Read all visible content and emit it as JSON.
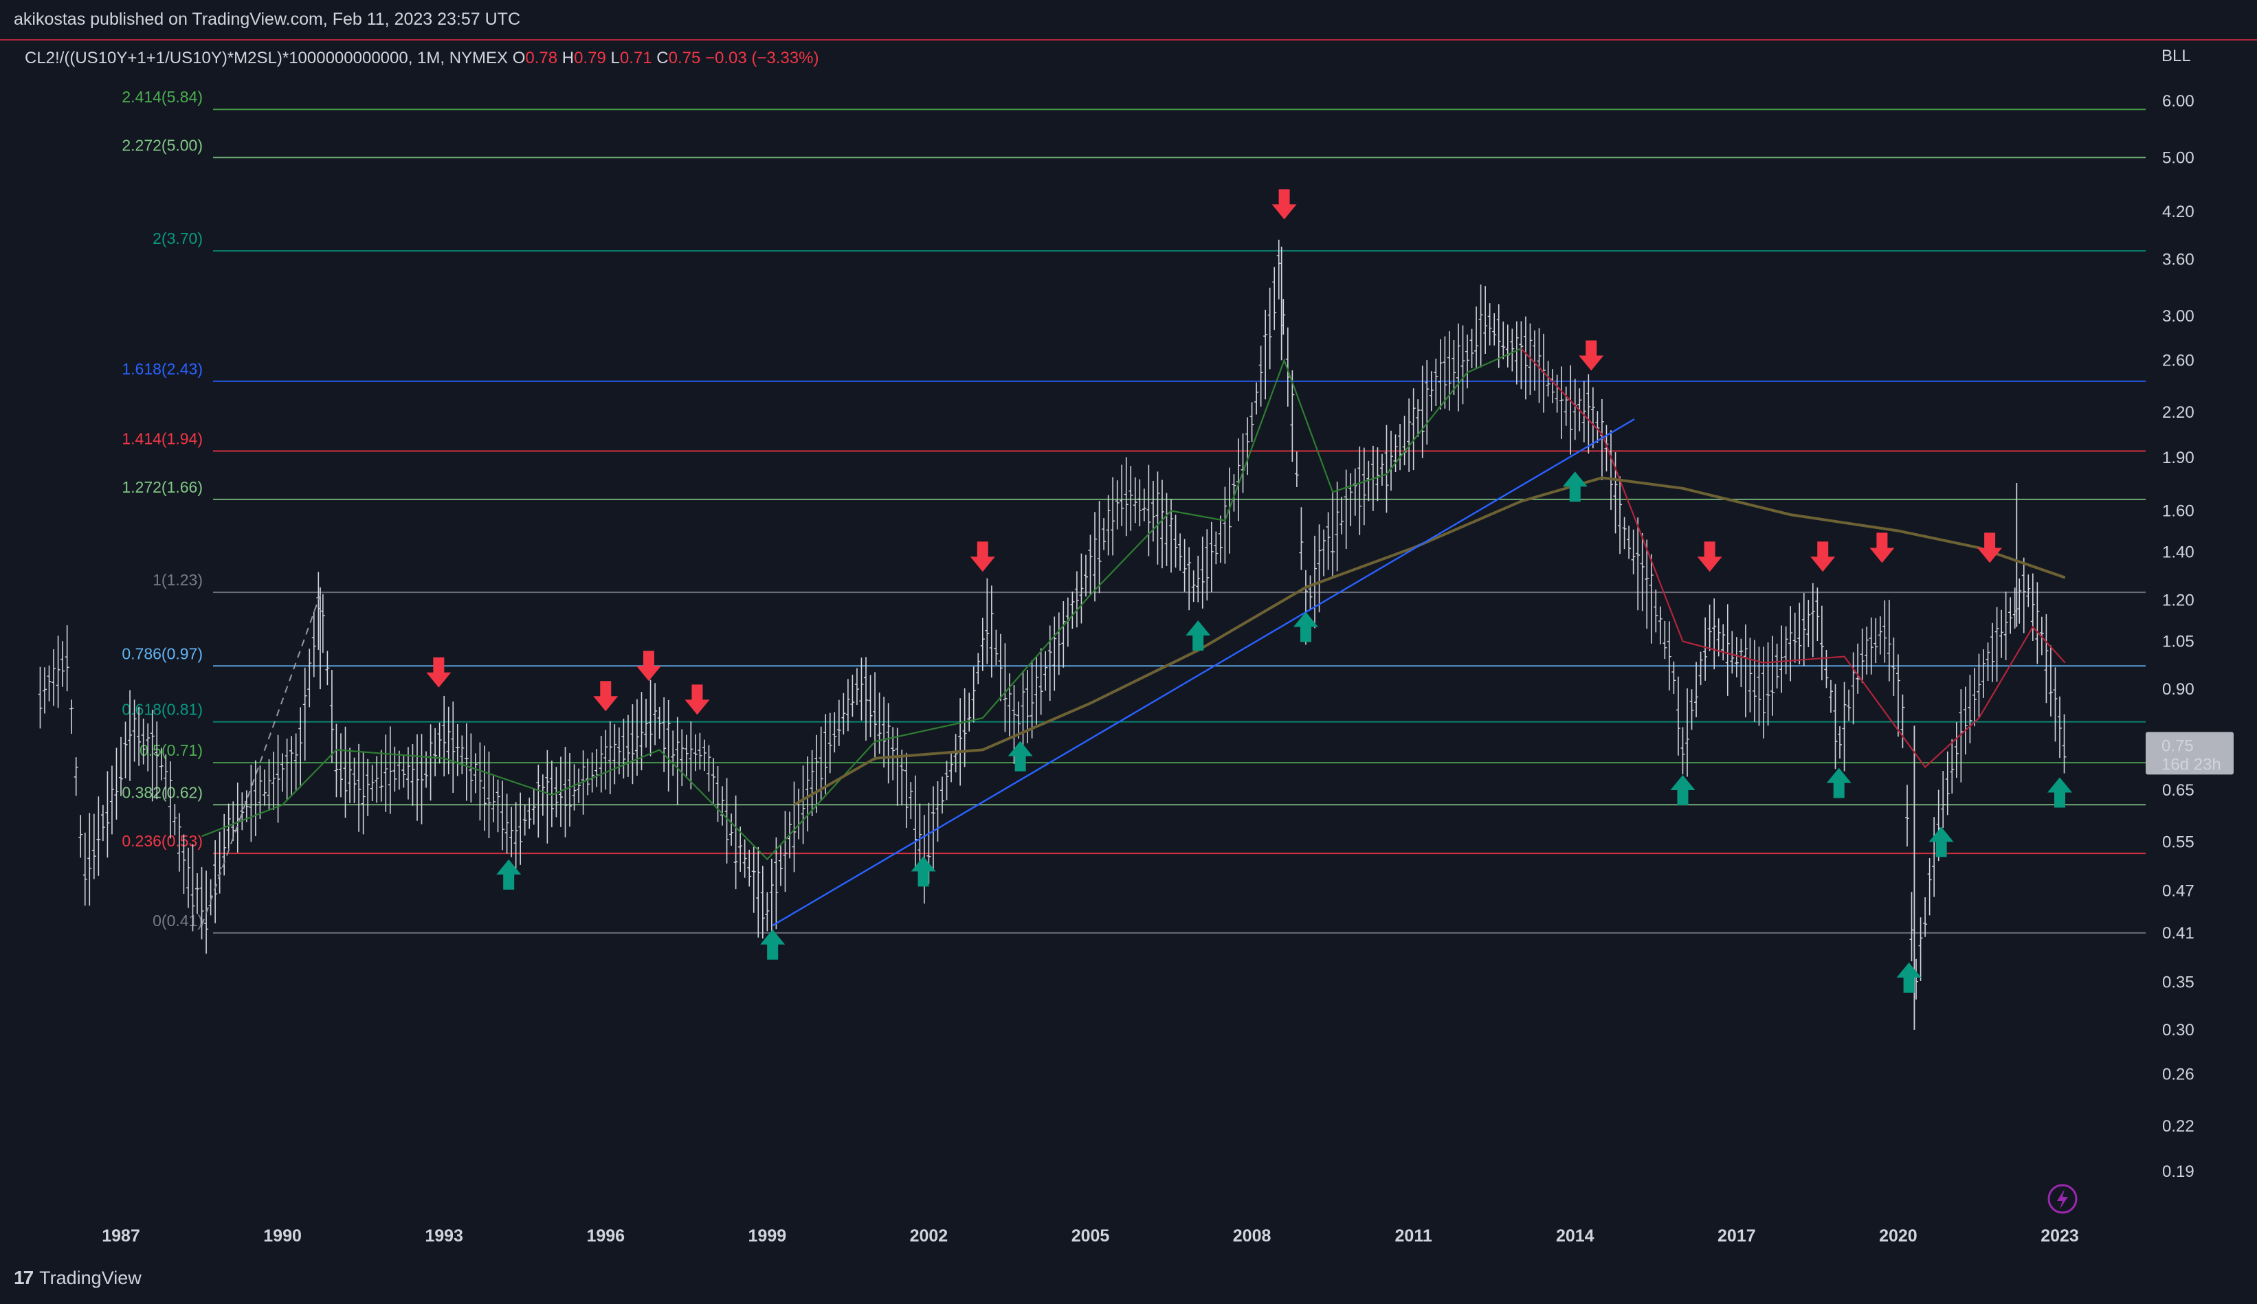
{
  "header": {
    "published": "akikostas published on TradingView.com, Feb 11, 2023 23:57 UTC"
  },
  "footer": {
    "brand": "TradingView"
  },
  "chart_data": {
    "type": "candlestick",
    "symbol_line": "CL2!/((US10Y+1+1/US10Y)*M2SL)*1000000000000, 1M, NYMEX",
    "ohlc": {
      "open_label": "O",
      "open": "0.78",
      "high_label": "H",
      "high": "0.79",
      "low_label": "L",
      "low": "0.71",
      "close_label": "C",
      "close": "0.75",
      "change": "−0.03 (−3.33%)"
    },
    "currency": "BLL",
    "y_scale": "log",
    "y_ticks": [
      "6.00",
      "5.00",
      "4.20",
      "3.60",
      "3.00",
      "2.60",
      "2.20",
      "1.90",
      "1.60",
      "1.40",
      "1.20",
      "1.05",
      "0.90",
      "0.75",
      "0.65",
      "0.55",
      "0.47",
      "0.41",
      "0.35",
      "0.30",
      "0.26",
      "0.22",
      "0.19"
    ],
    "last_price": {
      "value": "0.75",
      "countdown": "16d 23h"
    },
    "x_ticks": [
      "1987",
      "1990",
      "1993",
      "1996",
      "1999",
      "2002",
      "2005",
      "2008",
      "2011",
      "2014",
      "2017",
      "2020",
      "2023"
    ],
    "fib_levels": [
      {
        "label": "2.414(5.84)",
        "value": 5.84,
        "color": "#4caf50"
      },
      {
        "label": "2.272(5.00)",
        "value": 5.0,
        "color": "#81c784"
      },
      {
        "label": "2(3.70)",
        "value": 3.7,
        "color": "#089981"
      },
      {
        "label": "1.618(2.43)",
        "value": 2.43,
        "color": "#2962ff"
      },
      {
        "label": "1.414(1.94)",
        "value": 1.94,
        "color": "#f23645"
      },
      {
        "label": "1.272(1.66)",
        "value": 1.66,
        "color": "#81c784"
      },
      {
        "label": "1(1.23)",
        "value": 1.23,
        "color": "#787b86"
      },
      {
        "label": "0.786(0.97)",
        "value": 0.97,
        "color": "#64b5f6"
      },
      {
        "label": "0.618(0.81)",
        "value": 0.81,
        "color": "#089981"
      },
      {
        "label": "0.5(0.71)",
        "value": 0.71,
        "color": "#4caf50"
      },
      {
        "label": "0.382(0.62)",
        "value": 0.62,
        "color": "#81c784"
      },
      {
        "label": "0.236(0.53)",
        "value": 0.53,
        "color": "#f23645"
      },
      {
        "label": "0(0.41)",
        "value": 0.41,
        "color": "#787b86"
      }
    ],
    "price_series": [
      {
        "t": 1985.5,
        "v": 0.88
      },
      {
        "t": 1986.0,
        "v": 1.0
      },
      {
        "t": 1986.3,
        "v": 0.5
      },
      {
        "t": 1986.8,
        "v": 0.62
      },
      {
        "t": 1987.2,
        "v": 0.8
      },
      {
        "t": 1987.8,
        "v": 0.7
      },
      {
        "t": 1988.2,
        "v": 0.5
      },
      {
        "t": 1988.6,
        "v": 0.44
      },
      {
        "t": 1989.0,
        "v": 0.58
      },
      {
        "t": 1989.6,
        "v": 0.65
      },
      {
        "t": 1990.3,
        "v": 0.72
      },
      {
        "t": 1990.7,
        "v": 1.22
      },
      {
        "t": 1991.0,
        "v": 0.72
      },
      {
        "t": 1991.5,
        "v": 0.65
      },
      {
        "t": 1992.0,
        "v": 0.7
      },
      {
        "t": 1992.6,
        "v": 0.68
      },
      {
        "t": 1993.0,
        "v": 0.78
      },
      {
        "t": 1993.4,
        "v": 0.72
      },
      {
        "t": 1994.0,
        "v": 0.62
      },
      {
        "t": 1994.3,
        "v": 0.56
      },
      {
        "t": 1994.8,
        "v": 0.64
      },
      {
        "t": 1995.5,
        "v": 0.66
      },
      {
        "t": 1996.0,
        "v": 0.72
      },
      {
        "t": 1996.5,
        "v": 0.76
      },
      {
        "t": 1996.9,
        "v": 0.84
      },
      {
        "t": 1997.3,
        "v": 0.72
      },
      {
        "t": 1997.8,
        "v": 0.74
      },
      {
        "t": 1998.3,
        "v": 0.58
      },
      {
        "t": 1998.7,
        "v": 0.5
      },
      {
        "t": 1999.0,
        "v": 0.44
      },
      {
        "t": 1999.4,
        "v": 0.56
      },
      {
        "t": 1999.8,
        "v": 0.66
      },
      {
        "t": 2000.3,
        "v": 0.8
      },
      {
        "t": 2000.7,
        "v": 0.92
      },
      {
        "t": 2001.2,
        "v": 0.78
      },
      {
        "t": 2001.7,
        "v": 0.62
      },
      {
        "t": 2001.9,
        "v": 0.52
      },
      {
        "t": 2002.3,
        "v": 0.66
      },
      {
        "t": 2002.8,
        "v": 0.86
      },
      {
        "t": 2003.1,
        "v": 1.15
      },
      {
        "t": 2003.6,
        "v": 0.8
      },
      {
        "t": 2004.0,
        "v": 0.9
      },
      {
        "t": 2004.5,
        "v": 1.08
      },
      {
        "t": 2005.0,
        "v": 1.35
      },
      {
        "t": 2005.6,
        "v": 1.7
      },
      {
        "t": 2006.2,
        "v": 1.6
      },
      {
        "t": 2006.6,
        "v": 1.45
      },
      {
        "t": 2006.9,
        "v": 1.25
      },
      {
        "t": 2007.4,
        "v": 1.45
      },
      {
        "t": 2007.9,
        "v": 1.95
      },
      {
        "t": 2008.3,
        "v": 2.8
      },
      {
        "t": 2008.5,
        "v": 3.5
      },
      {
        "t": 2008.8,
        "v": 2.0
      },
      {
        "t": 2009.0,
        "v": 1.18
      },
      {
        "t": 2009.4,
        "v": 1.45
      },
      {
        "t": 2009.9,
        "v": 1.7
      },
      {
        "t": 2010.5,
        "v": 1.85
      },
      {
        "t": 2011.0,
        "v": 2.1
      },
      {
        "t": 2011.5,
        "v": 2.5
      },
      {
        "t": 2012.0,
        "v": 2.6
      },
      {
        "t": 2012.3,
        "v": 3.0
      },
      {
        "t": 2012.8,
        "v": 2.7
      },
      {
        "t": 2013.3,
        "v": 2.6
      },
      {
        "t": 2013.8,
        "v": 2.25
      },
      {
        "t": 2014.3,
        "v": 2.2
      },
      {
        "t": 2014.6,
        "v": 1.95
      },
      {
        "t": 2014.9,
        "v": 1.5
      },
      {
        "t": 2015.3,
        "v": 1.3
      },
      {
        "t": 2015.8,
        "v": 0.98
      },
      {
        "t": 2016.0,
        "v": 0.74
      },
      {
        "t": 2016.5,
        "v": 1.1
      },
      {
        "t": 2017.0,
        "v": 1.0
      },
      {
        "t": 2017.5,
        "v": 0.9
      },
      {
        "t": 2018.0,
        "v": 1.05
      },
      {
        "t": 2018.5,
        "v": 1.15
      },
      {
        "t": 2018.9,
        "v": 0.75
      },
      {
        "t": 2019.3,
        "v": 1.0
      },
      {
        "t": 2019.8,
        "v": 1.1
      },
      {
        "t": 2020.1,
        "v": 0.8
      },
      {
        "t": 2020.3,
        "v": 0.34
      },
      {
        "t": 2020.8,
        "v": 0.62
      },
      {
        "t": 2021.2,
        "v": 0.8
      },
      {
        "t": 2021.7,
        "v": 1.0
      },
      {
        "t": 2022.1,
        "v": 1.15
      },
      {
        "t": 2022.4,
        "v": 1.25
      },
      {
        "t": 2022.7,
        "v": 1.05
      },
      {
        "t": 2023.0,
        "v": 0.8
      },
      {
        "t": 2023.1,
        "v": 0.75
      }
    ],
    "ma_short": [
      {
        "t": 1988.5,
        "v": 0.56
      },
      {
        "t": 1990.0,
        "v": 0.62
      },
      {
        "t": 1991.0,
        "v": 0.74
      },
      {
        "t": 1993.0,
        "v": 0.72
      },
      {
        "t": 1995.0,
        "v": 0.64
      },
      {
        "t": 1997.0,
        "v": 0.74
      },
      {
        "t": 1999.0,
        "v": 0.52
      },
      {
        "t": 2001.0,
        "v": 0.76
      },
      {
        "t": 2003.0,
        "v": 0.82
      },
      {
        "t": 2005.0,
        "v": 1.22
      },
      {
        "t": 2006.5,
        "v": 1.6
      },
      {
        "t": 2007.5,
        "v": 1.55
      },
      {
        "t": 2008.6,
        "v": 2.6
      },
      {
        "t": 2009.5,
        "v": 1.7
      },
      {
        "t": 2010.5,
        "v": 1.8
      },
      {
        "t": 2012.0,
        "v": 2.5
      },
      {
        "t": 2013.0,
        "v": 2.7
      },
      {
        "t": 2014.5,
        "v": 2.05
      },
      {
        "t": 2016.0,
        "v": 1.05
      },
      {
        "t": 2017.5,
        "v": 0.98
      },
      {
        "t": 2019.0,
        "v": 1.0
      },
      {
        "t": 2020.5,
        "v": 0.7
      },
      {
        "t": 2021.5,
        "v": 0.82
      },
      {
        "t": 2022.5,
        "v": 1.1
      },
      {
        "t": 2023.1,
        "v": 0.98
      }
    ],
    "ma_long": [
      {
        "t": 1999.5,
        "v": 0.62
      },
      {
        "t": 2001.0,
        "v": 0.72
      },
      {
        "t": 2003.0,
        "v": 0.74
      },
      {
        "t": 2005.0,
        "v": 0.86
      },
      {
        "t": 2007.0,
        "v": 1.02
      },
      {
        "t": 2009.0,
        "v": 1.25
      },
      {
        "t": 2011.0,
        "v": 1.42
      },
      {
        "t": 2013.0,
        "v": 1.65
      },
      {
        "t": 2014.5,
        "v": 1.78
      },
      {
        "t": 2016.0,
        "v": 1.72
      },
      {
        "t": 2018.0,
        "v": 1.58
      },
      {
        "t": 2020.0,
        "v": 1.5
      },
      {
        "t": 2021.5,
        "v": 1.42
      },
      {
        "t": 2023.1,
        "v": 1.29
      }
    ],
    "trendline": {
      "from": {
        "t": 1999.1,
        "v": 0.42
      },
      "to": {
        "t": 2015.1,
        "v": 2.15
      }
    },
    "dashed_line": {
      "from": {
        "t": 1988.5,
        "v": 0.42
      },
      "to": {
        "t": 1990.7,
        "v": 1.22
      }
    },
    "down_arrows": [
      {
        "t": 1992.9,
        "v": 0.95
      },
      {
        "t": 1996.0,
        "v": 0.88
      },
      {
        "t": 1996.8,
        "v": 0.97
      },
      {
        "t": 1997.7,
        "v": 0.87
      },
      {
        "t": 2003.0,
        "v": 1.38
      },
      {
        "t": 2008.6,
        "v": 4.3
      },
      {
        "t": 2014.3,
        "v": 2.64
      },
      {
        "t": 2016.5,
        "v": 1.38
      },
      {
        "t": 2018.6,
        "v": 1.38
      },
      {
        "t": 2019.7,
        "v": 1.42
      },
      {
        "t": 2021.7,
        "v": 1.42
      }
    ],
    "up_arrows": [
      {
        "t": 1994.2,
        "v": 0.495
      },
      {
        "t": 1999.1,
        "v": 0.395
      },
      {
        "t": 2001.9,
        "v": 0.5
      },
      {
        "t": 2003.7,
        "v": 0.725
      },
      {
        "t": 2007.0,
        "v": 1.07
      },
      {
        "t": 2009.0,
        "v": 1.1
      },
      {
        "t": 2014.0,
        "v": 1.73
      },
      {
        "t": 2016.0,
        "v": 0.65
      },
      {
        "t": 2018.9,
        "v": 0.665
      },
      {
        "t": 2020.2,
        "v": 0.355
      },
      {
        "t": 2020.8,
        "v": 0.55
      },
      {
        "t": 2023.0,
        "v": 0.645
      }
    ],
    "colors": {
      "background": "#131722",
      "up_arrow": "#089981",
      "down_arrow": "#f23645",
      "ma_short": "#2e7d32",
      "ma_short_red": "#b2243a",
      "ma_long": "#6d6233",
      "trendline": "#2962ff",
      "bars": "#d1d4dc"
    }
  }
}
